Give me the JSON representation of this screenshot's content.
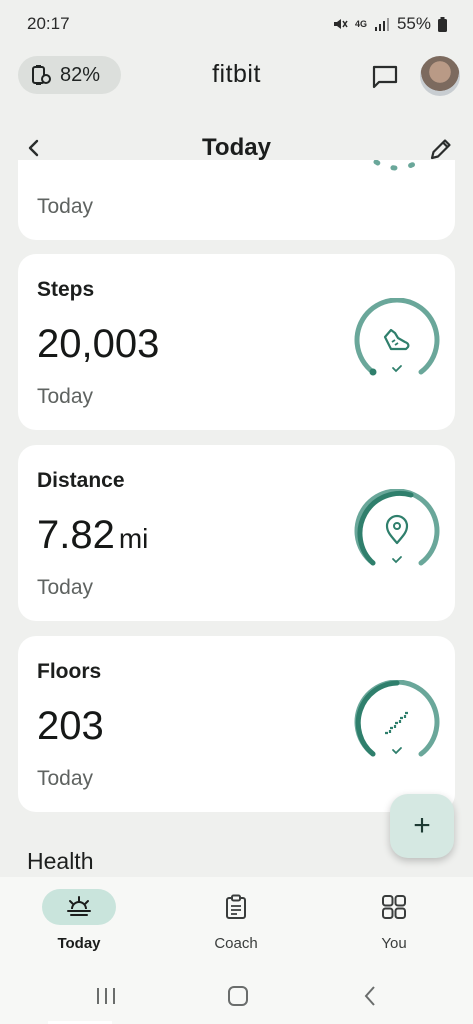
{
  "status_bar": {
    "time": "20:17",
    "network": "4G",
    "battery": "55%"
  },
  "header": {
    "device_battery": "82%",
    "app_title": "fitbit",
    "icons": {
      "device": "watch-battery-icon",
      "chat": "chat-icon",
      "avatar": "profile-avatar"
    }
  },
  "sub_header": {
    "title": "Today",
    "icons": {
      "back": "chevron-left-icon",
      "edit": "pencil-icon"
    }
  },
  "cards": {
    "partial": {
      "subtitle": "Today"
    },
    "steps": {
      "label": "Steps",
      "value": "20,003",
      "subtitle": "Today",
      "icon": "shoe-icon",
      "progress": 1.0
    },
    "distance": {
      "label": "Distance",
      "value": "7.82",
      "unit": "mi",
      "subtitle": "Today",
      "icon": "location-pin-icon",
      "progress": 1.0
    },
    "floors": {
      "label": "Floors",
      "value": "203",
      "subtitle": "Today",
      "icon": "stairs-icon",
      "progress": 1.0
    }
  },
  "fab": {
    "label": "+"
  },
  "section": {
    "title": "Health"
  },
  "bottom_nav": {
    "items": [
      {
        "label": "Today",
        "icon": "sunrise-icon",
        "active": true
      },
      {
        "label": "Coach",
        "icon": "clipboard-icon",
        "active": false
      },
      {
        "label": "You",
        "icon": "grid-icon",
        "active": false
      }
    ]
  },
  "colors": {
    "accent": "#2f7f6c",
    "ring_light": "#6aa79a",
    "nav_active_bg": "#c9e4dc",
    "page_bg": "#eff0ee"
  }
}
